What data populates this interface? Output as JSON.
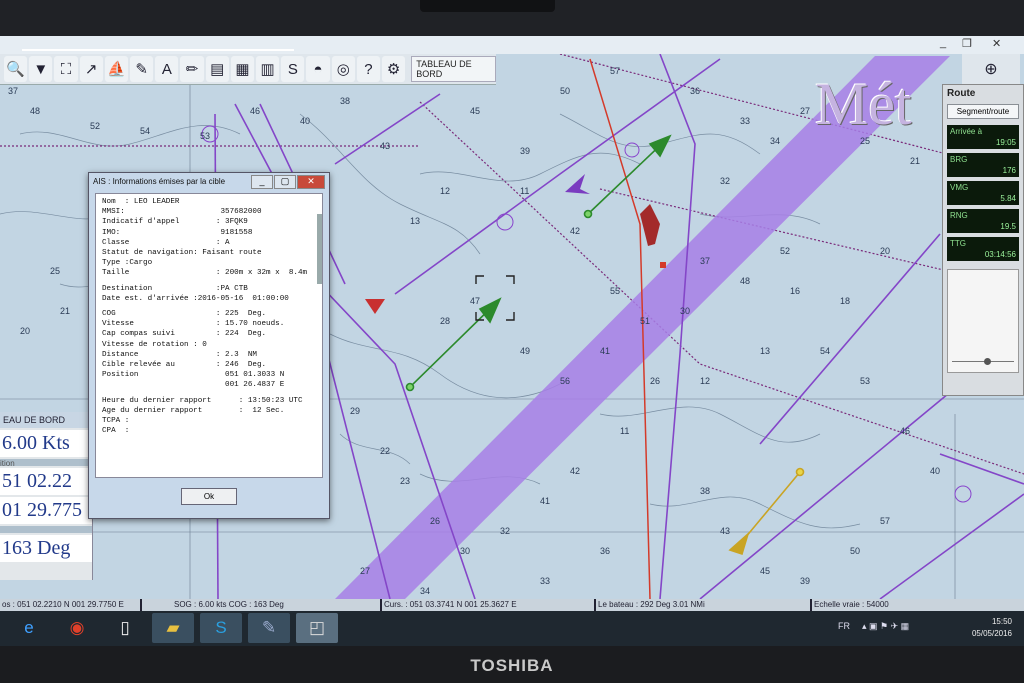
{
  "window": {
    "minimize": "_",
    "restore": "❐",
    "close": "✕"
  },
  "toolbar": {
    "icons": [
      "search-icon",
      "waypoint-icon",
      "person-icon",
      "track-icon",
      "boat-icon",
      "measure-icon",
      "text-icon",
      "pencil-icon",
      "layers-icon",
      "chart-icon",
      "table-icon",
      "route-icon",
      "sunset-icon",
      "lifebuoy-icon",
      "help-icon",
      "settings-icon"
    ],
    "glyphs": [
      "🔍",
      "▼",
      "⛶",
      "↗",
      "⛵",
      "✎",
      "A",
      "✏",
      "▤",
      "▦",
      "▥",
      "S",
      "◓",
      "◎",
      "?",
      "⚙"
    ],
    "label": "TABLEAU DE BORD"
  },
  "watermark": "Mét",
  "route_panel": {
    "title": "Route",
    "segment_button": "Segment/route",
    "fields": [
      {
        "key": "Arrivée à",
        "value": "19:05"
      },
      {
        "key": "BRG",
        "value": "176"
      },
      {
        "key": "VMG",
        "value": "5.84"
      },
      {
        "key": "RNG",
        "value": "19.5"
      },
      {
        "key": "TTG",
        "value": "03:14:56"
      }
    ]
  },
  "left_panel": {
    "title": "EAU DE BORD",
    "speed": "6.00 Kts",
    "sub1": "ition",
    "lat": "51 02.22",
    "lon": "01 29.775",
    "heading": "163 Deg"
  },
  "ais_dialog": {
    "title": "AIS : Informations émises par la cible",
    "rows": [
      "Nom  : LEO LEADER",
      "MMSI:                     357682000",
      "Indicatif d'appel        : 3FQK9",
      "IMO:                      9181558",
      "Classe                   : A",
      "Statut de navigation: Faisant route",
      "Type :Cargo",
      "Taille                   : 200m x 32m x  8.4m",
      "Destination              :PA CTB",
      "Date est. d'arrivée :2016-05-16  01:00:00",
      "COG                      : 225  Deg.",
      "Vitesse                  : 15.70 noeuds.",
      "Cap compas suivi         : 224  Deg.",
      "Vitesse de rotation : 0",
      "Distance                 : 2.3  NM",
      "Cible relevée au         : 246  Deg.",
      "Position                   051 01.3033 N",
      "                           001 26.4837 E",
      "Heure du dernier rapport      : 13:50:23 UTC",
      "Age du dernier rapport        :  12 Sec.",
      "TCPA :",
      "CPA  :"
    ],
    "ok": "Ok"
  },
  "status_bar": {
    "pos": "os : 051 02.2210 N  001 29.7750 E",
    "sog": "SOG : 6.00 kts  COG :   163 Deg",
    "curs": "Curs. : 051 03.3741 N 001 25.3627 E",
    "bateau": "Le bateau : 292 Deg    3.01 NMi",
    "echelle": "Echelle vraie :       54000"
  },
  "taskbar": {
    "apps": [
      "ie-icon",
      "chrome-icon",
      "file-icon",
      "explorer-icon",
      "skype-icon",
      "notes-icon",
      "nav-app-icon"
    ],
    "glyphs": [
      "e",
      "◉",
      "▯",
      "▰",
      "S",
      "✎",
      "◰"
    ],
    "lang": "FR",
    "tray_icons": "▴  ▣  ⚑  ✈  ▦",
    "time": "15:50",
    "date": "05/05/2016"
  },
  "brand": "TOSHIBA",
  "colors": {
    "route_band": "#a77fe6",
    "route_line": "#8844cc",
    "green_vector": "#2c8a2c",
    "ais_target": "#a33"
  },
  "depths": [
    "37",
    "48",
    "52",
    "54",
    "53",
    "46",
    "40",
    "38",
    "43",
    "45",
    "39",
    "50",
    "57",
    "36",
    "33",
    "34",
    "27",
    "25",
    "21",
    "20",
    "18",
    "16",
    "13",
    "12",
    "11",
    "42",
    "41",
    "32",
    "30",
    "26",
    "23",
    "22",
    "29",
    "24",
    "28",
    "47",
    "49",
    "56",
    "55",
    "51"
  ]
}
